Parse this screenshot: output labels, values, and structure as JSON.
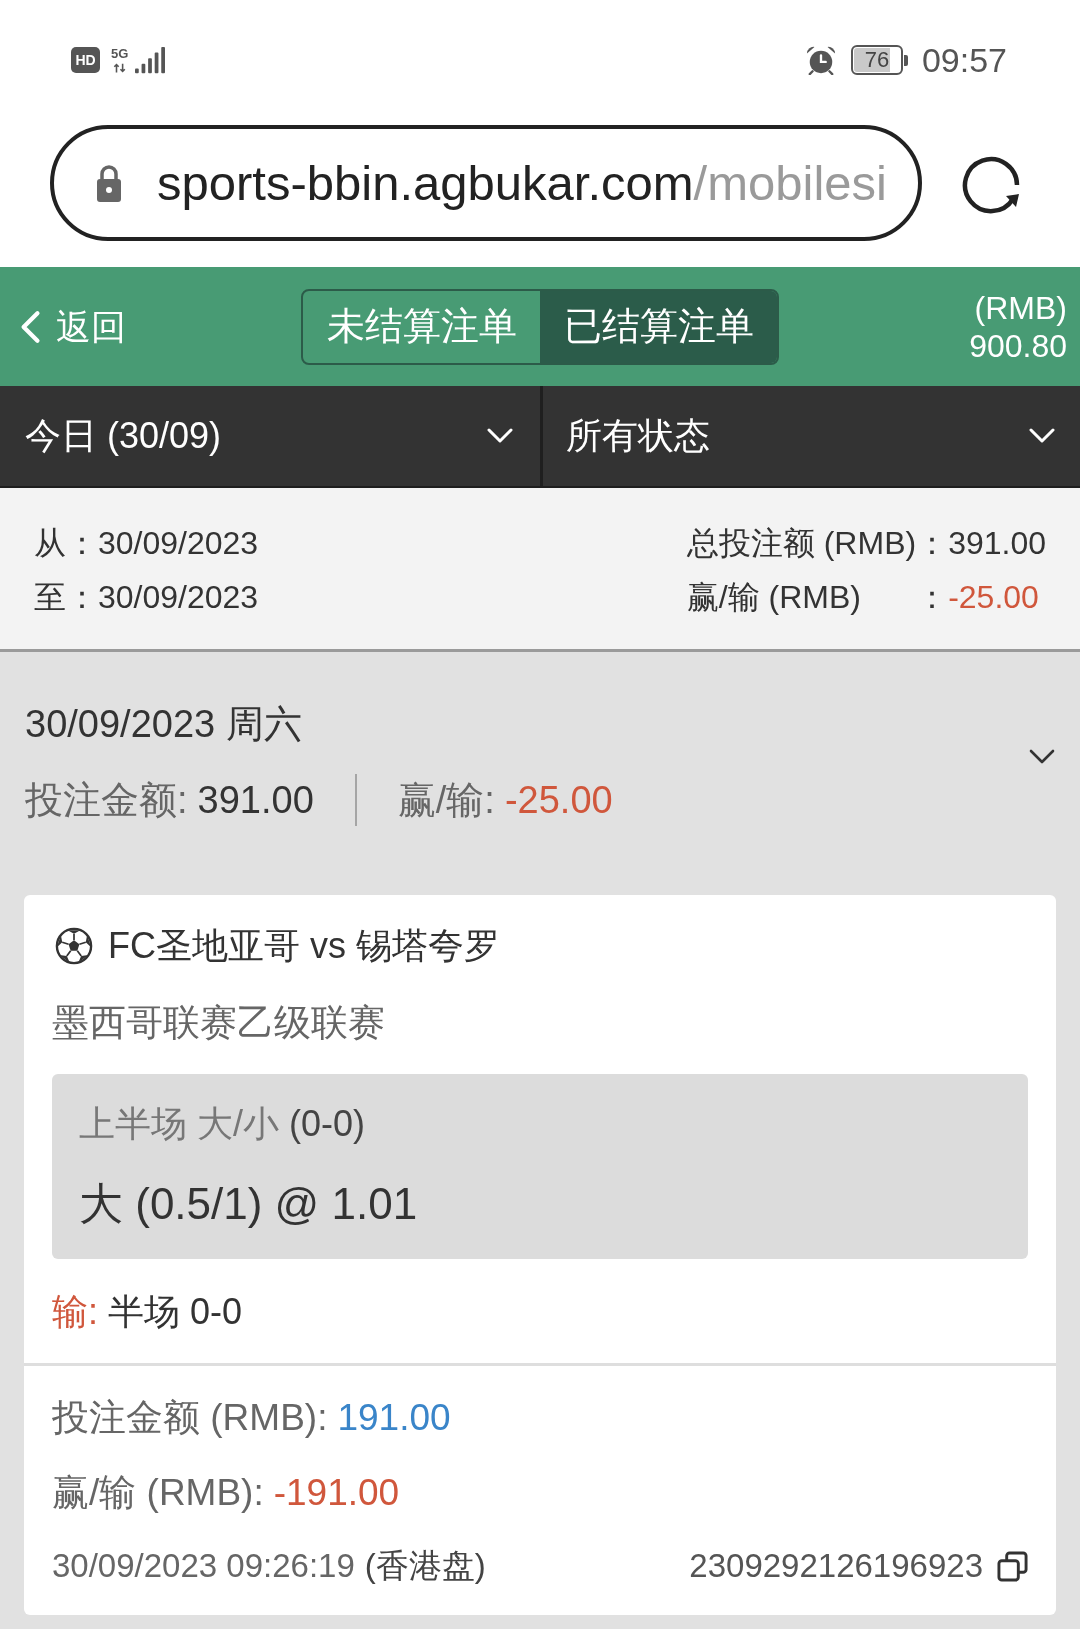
{
  "status_bar": {
    "hd_badge": "HD",
    "network": "5G",
    "battery": "76",
    "time": "09:57"
  },
  "address_bar": {
    "domain": "sports-bbin.agbukar.com",
    "path": "/mobilesi"
  },
  "header": {
    "back": "返回",
    "tabs": [
      {
        "label": "未结算注单",
        "selected": false
      },
      {
        "label": "已结算注单",
        "selected": true
      }
    ],
    "balance_currency": "(RMB)",
    "balance": "900.80"
  },
  "filters": [
    {
      "label": "今日 (30/09)"
    },
    {
      "label": "所有状态"
    }
  ],
  "summary": {
    "period": [
      {
        "label": "从",
        "separator": "：",
        "value": "30/09/2023"
      },
      {
        "label": "至",
        "separator": "：",
        "value": "30/09/2023"
      }
    ],
    "totals": [
      {
        "label": "总投注额 (RMB)",
        "separator": "：",
        "value": "391.00",
        "negative": false
      },
      {
        "label": "赢/输 (RMB)",
        "separator": "：",
        "value": "-25.00",
        "negative": true
      }
    ]
  },
  "day_groups": [
    {
      "date": "30/09/2023 周六",
      "stake_label": "投注金额:",
      "stake": "391.00",
      "result_label": "赢/输:",
      "result": "-25.00",
      "result_negative": true,
      "bets": [
        {
          "kind": "soccer",
          "match": "FC圣地亚哥 vs 锡塔夸罗",
          "league": "墨西哥联赛乙级联赛",
          "market": "上半场 大/小",
          "market_score": "(0-0)",
          "selection": "大 (0.5/1) @ 1.01",
          "outcome_label": "输:",
          "outcome_negative": true,
          "outcome": "半场 0-0",
          "stake_label": "投注金额 (RMB):",
          "stake": "191.00",
          "win_loss_label": "赢/输 (RMB):",
          "win_loss": "-191.00",
          "win_loss_negative": true,
          "placed_at": "30/09/2023 09:26:19",
          "odds_type": "(香港盘)",
          "ticket_no": "2309292126196923"
        }
      ]
    }
  ]
}
